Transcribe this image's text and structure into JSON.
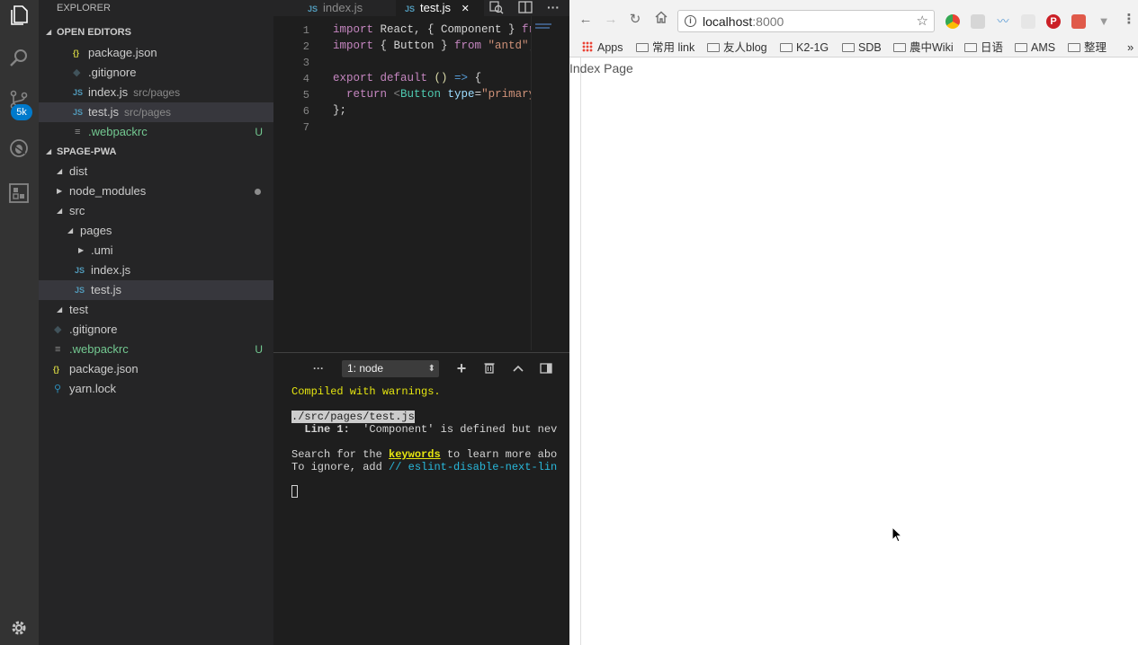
{
  "explorer": {
    "title": "EXPLORER",
    "open_editors_label": "OPEN EDITORS",
    "open_editors": [
      {
        "name": "package.json",
        "desc": "",
        "status": ""
      },
      {
        "name": ".gitignore",
        "desc": "",
        "status": ""
      },
      {
        "name": "index.js",
        "desc": "src/pages",
        "status": ""
      },
      {
        "name": "test.js",
        "desc": "src/pages",
        "status": ""
      },
      {
        "name": ".webpackrc",
        "desc": "",
        "status": "U"
      }
    ],
    "project_label": "SPAGE-PWA",
    "tree": [
      {
        "name": "dist"
      },
      {
        "name": "node_modules"
      },
      {
        "name": "src"
      },
      {
        "name": "pages"
      },
      {
        "name": ".umi"
      },
      {
        "name": "index.js"
      },
      {
        "name": "test.js"
      },
      {
        "name": "test"
      },
      {
        "name": ".gitignore"
      },
      {
        "name": ".webpackrc",
        "status": "U"
      },
      {
        "name": "package.json"
      },
      {
        "name": "yarn.lock"
      }
    ]
  },
  "activity": {
    "scm_badge": "5k"
  },
  "tabs": [
    {
      "name": "index.js",
      "type": "JS"
    },
    {
      "name": "test.js",
      "type": "JS",
      "close": "✕"
    }
  ],
  "editor": {
    "line_numbers": [
      "1",
      "2",
      "3",
      "4",
      "5",
      "6",
      "7"
    ],
    "lines": {
      "l1": {
        "kw": "import",
        "a": " React, { Component } ",
        "kw2": "fro"
      },
      "l2": {
        "kw": "import",
        "a": " { Button } ",
        "kw2": "from",
        "str": " \"antd\"",
        "end": ";"
      },
      "l4": {
        "kw": "export",
        "kw_b": " default",
        "a": " () ",
        "arrow": "=>",
        "b": " {"
      },
      "l5": {
        "kw": "  return",
        "open": " <",
        "tag": "Button",
        "attr": " type",
        "eq": "=",
        "str": "\"primary\""
      },
      "l6": {
        "a": "};"
      }
    }
  },
  "terminal": {
    "selected": "1: node",
    "lines": {
      "compiled": "Compiled with warnings.",
      "path": "./src/pages/test.js",
      "line_label": "Line 1:",
      "warning": "  'Component' is defined but nev",
      "search_pre": "Search for the ",
      "search_kw": "keywords",
      "search_post": " to learn more abo",
      "ignore_pre": "To ignore, add ",
      "ignore_code": "// eslint-disable-next-lin"
    }
  },
  "browser": {
    "url_host": "localhost",
    "url_port": ":8000",
    "bookmarks": [
      "Apps",
      "常用 link",
      "友人blog",
      "K2-1G",
      "SDB",
      "農中Wiki",
      "日语",
      "AMS",
      "整理"
    ],
    "more": "»",
    "page_text": "Index Page"
  }
}
